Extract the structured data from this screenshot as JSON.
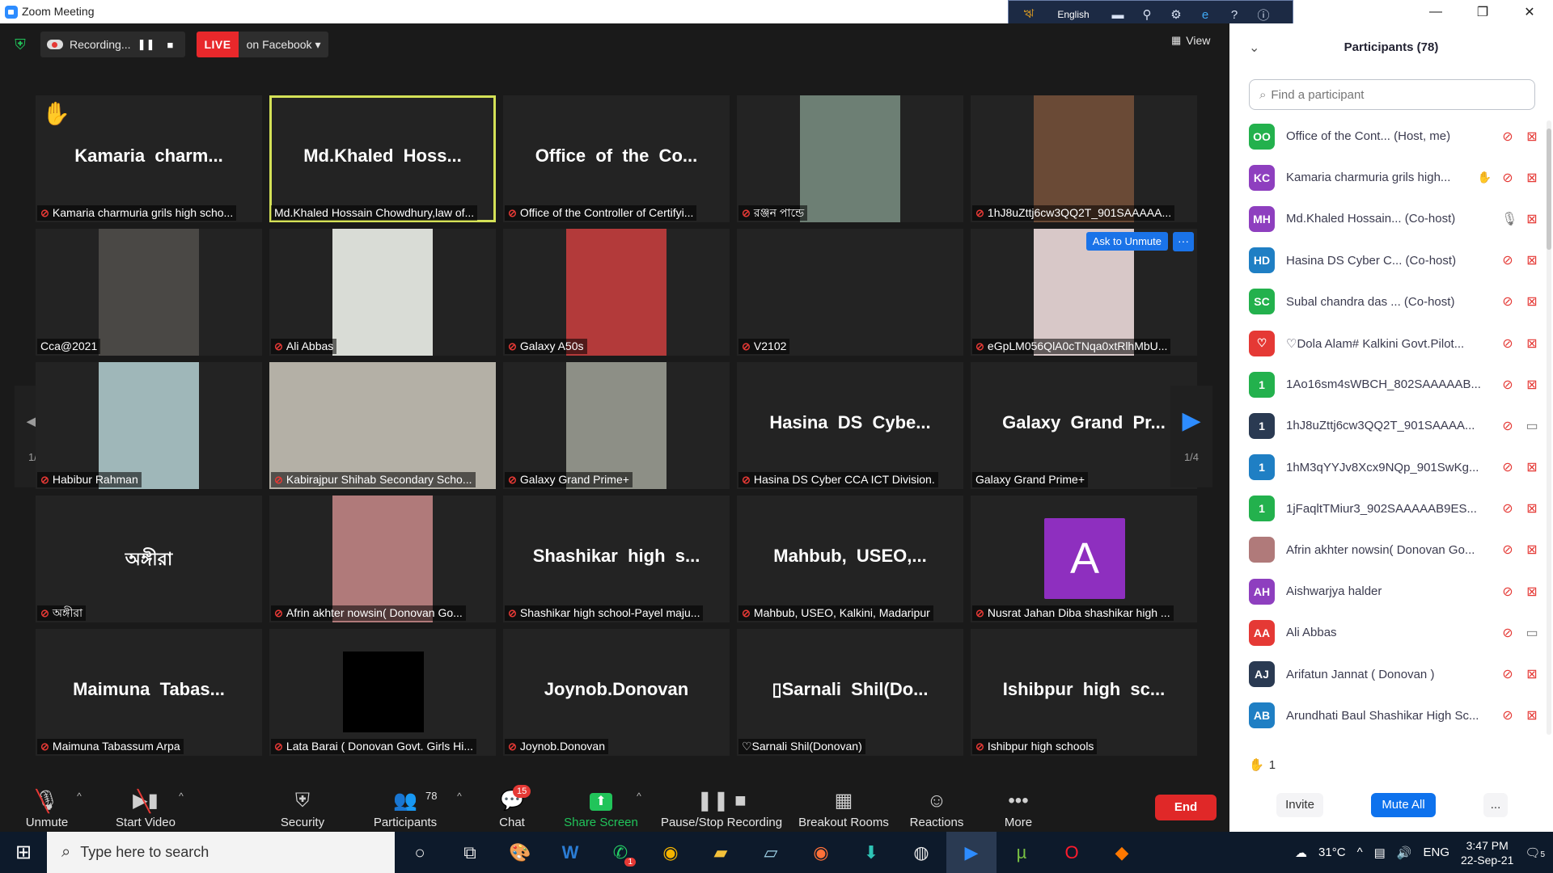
{
  "window": {
    "title": "Zoom Meeting"
  },
  "lang_toolbar": {
    "language": "English"
  },
  "recording": {
    "label": "Recording..."
  },
  "live": {
    "badge": "LIVE",
    "target": "on Facebook"
  },
  "view": {
    "label": "View"
  },
  "tiles": [
    {
      "big": "Kamaria  charm...",
      "cap": "Kamaria charmuria grils high scho...",
      "muted": true,
      "hand": true
    },
    {
      "big": "Md.Khaled  Hoss...",
      "cap": "Md.Khaled Hossain Chowdhury,law of...",
      "muted": false,
      "active": true
    },
    {
      "big": "Office  of  the  Co...",
      "cap": "Office of the Controller of Certifyi...",
      "muted": true
    },
    {
      "big": "",
      "cap": "রঞ্জন পান্ডে",
      "muted": true,
      "video": "#6d7f74"
    },
    {
      "big": "",
      "cap": "1hJ8uZttj6cw3QQ2T_901SAAAAA...",
      "muted": true,
      "video": "#6a4a36"
    },
    {
      "big": "",
      "cap": "Cca@2021",
      "muted": false,
      "video": "#4a4845"
    },
    {
      "big": "",
      "cap": "Ali Abbas",
      "muted": true,
      "video": "#d9dcd6"
    },
    {
      "big": "",
      "cap": "Galaxy A50s",
      "muted": true,
      "video": "#b33a3a"
    },
    {
      "big": "",
      "cap": "V2102",
      "muted": true
    },
    {
      "big": "",
      "cap": "eGpLM056QlA0cTNqa0xtRlhMbU...",
      "muted": true,
      "video": "#d8c8c8",
      "ask": "Ask to Unmute"
    },
    {
      "big": "",
      "cap": "Habibur Rahman",
      "muted": true,
      "video": "#9fb7b9"
    },
    {
      "big": "",
      "cap": "Kabirajpur Shihab Secondary Scho...",
      "muted": true,
      "video": "#b4b0a6",
      "wide": true
    },
    {
      "big": "",
      "cap": "Galaxy Grand Prime+",
      "muted": true,
      "video": "#8d8f86"
    },
    {
      "big": "Hasina  DS  Cybe...",
      "cap": "Hasina DS Cyber CCA ICT Division.",
      "muted": true
    },
    {
      "big": "Galaxy  Grand  Pr...",
      "cap": "Galaxy Grand Prime+",
      "muted": false
    },
    {
      "big": "অঙ্গীরা",
      "cap": "অঙ্গীরা",
      "muted": true
    },
    {
      "big": "",
      "cap": "Afrin akhter nowsin( Donovan Go...",
      "muted": true,
      "video": "#b07a7a"
    },
    {
      "big": "Shashikar  high  s...",
      "cap": "Shashikar high school-Payel maju...",
      "muted": true
    },
    {
      "big": "Mahbub,  USEO,...",
      "cap": "Mahbub, USEO, Kalkini, Madaripur",
      "muted": true
    },
    {
      "big": "",
      "cap": "Nusrat Jahan Diba shashikar high ...",
      "muted": true,
      "avatar": "A"
    },
    {
      "big": "Maimuna  Tabas...",
      "cap": "Maimuna Tabassum Arpa",
      "muted": true
    },
    {
      "big": "",
      "cap": "Lata Barai ( Donovan Govt. Girls Hi...",
      "muted": true,
      "black": true
    },
    {
      "big": "Joynob.Donovan",
      "cap": "Joynob.Donovan",
      "muted": true
    },
    {
      "big": "▯Sarnali  Shil(Do...",
      "cap": "♡Sarnali Shil(Donovan)",
      "muted": false
    },
    {
      "big": "Ishibpur  high  sc...",
      "cap": "Ishibpur high schools",
      "muted": true
    }
  ],
  "pager": {
    "label": "1/4"
  },
  "toolbar": {
    "unmute": "Unmute",
    "start_video": "Start Video",
    "security": "Security",
    "participants": "Participants",
    "participants_count": "78",
    "chat": "Chat",
    "chat_badge": "15",
    "share_screen": "Share Screen",
    "pause_recording": "Pause/Stop Recording",
    "breakout": "Breakout Rooms",
    "reactions": "Reactions",
    "more": "More",
    "end": "End"
  },
  "panel": {
    "title": "Participants (78)",
    "search_placeholder": "Find a participant",
    "participants": [
      {
        "initials": "OO",
        "color": "#23b14d",
        "name": "Office of the Cont...  (Host, me)",
        "mic_on": false,
        "cam_on": false
      },
      {
        "initials": "KC",
        "color": "#8e3fbf",
        "name": "Kamaria charmuria grils high...",
        "mic_on": false,
        "cam_on": false,
        "hand": true
      },
      {
        "initials": "MH",
        "color": "#8e3fbf",
        "name": "Md.Khaled Hossain...  (Co-host)",
        "mic_on": true,
        "cam_on": false
      },
      {
        "initials": "HD",
        "color": "#1f7fc4",
        "name": "Hasina DS Cyber C...  (Co-host)",
        "mic_on": false,
        "cam_on": false
      },
      {
        "initials": "SC",
        "color": "#23b14d",
        "name": "Subal chandra das ...  (Co-host)",
        "mic_on": false,
        "cam_on": false
      },
      {
        "initials": "♡",
        "color": "#e53935",
        "name": "♡Dola Alam# Kalkini Govt.Pilot...",
        "mic_on": false,
        "cam_on": false
      },
      {
        "initials": "1",
        "color": "#23b14d",
        "name": "1Ao16sm4sWBCH_802SAAAAAB...",
        "mic_on": false,
        "cam_on": false
      },
      {
        "initials": "1",
        "color": "#2a3a52",
        "name": "1hJ8uZttj6cw3QQ2T_901SAAAA...",
        "mic_on": false,
        "cam_on": true
      },
      {
        "initials": "1",
        "color": "#1f7fc4",
        "name": "1hM3qYYJv8Xcx9NQp_901SwKg...",
        "mic_on": false,
        "cam_on": false
      },
      {
        "initials": "1",
        "color": "#23b14d",
        "name": "1jFaqltTMiur3_902SAAAAAB9ES...",
        "mic_on": false,
        "cam_on": false
      },
      {
        "initials": "",
        "color": "#b07a7a",
        "name": "Afrin akhter nowsin( Donovan Go...",
        "mic_on": false,
        "cam_on": false
      },
      {
        "initials": "AH",
        "color": "#8e3fbf",
        "name": "Aishwarjya halder",
        "mic_on": false,
        "cam_on": false
      },
      {
        "initials": "AA",
        "color": "#e53935",
        "name": "Ali Abbas",
        "mic_on": false,
        "cam_on": true
      },
      {
        "initials": "AJ",
        "color": "#2a3a52",
        "name": "Arifatun Jannat ( Donovan )",
        "mic_on": false,
        "cam_on": false
      },
      {
        "initials": "AB",
        "color": "#1f7fc4",
        "name": "Arundhati Baul Shashikar High Sc...",
        "mic_on": false,
        "cam_on": false
      }
    ],
    "raised_count": "1",
    "invite": "Invite",
    "mute_all": "Mute All",
    "more": "..."
  },
  "taskbar": {
    "search_placeholder": "Type here to search",
    "weather": "31°C",
    "lang": "ENG",
    "time": "3:47 PM",
    "date": "22-Sep-21",
    "whatsapp_badge": "1",
    "notif": "5"
  }
}
